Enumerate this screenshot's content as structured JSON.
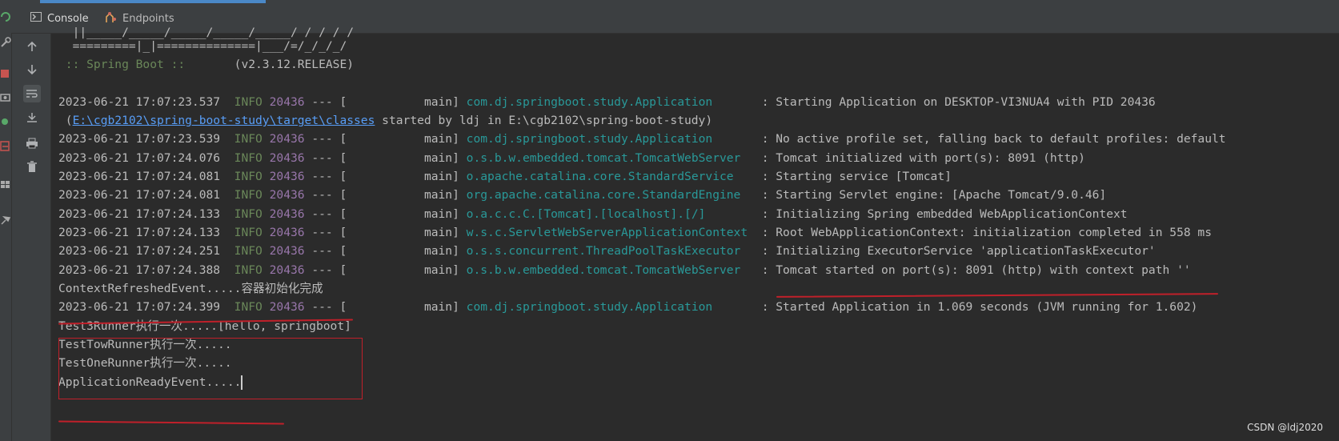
{
  "tabs": [
    {
      "label": "Console",
      "icon": "console-icon",
      "active": true
    },
    {
      "label": "Endpoints",
      "icon": "endpoints-icon",
      "active": false
    }
  ],
  "banner": {
    "line1": "  =========|_|==============|___/=/_/_/_/",
    "line2": " :: Spring Boot :: ",
    "line2_version": "      (v2.3.12.RELEASE)"
  },
  "log": [
    {
      "ts": "2023-06-21 17:07:23.537",
      "level": "INFO",
      "pid": "20436",
      "thread": "main",
      "logger": "com.dj.springboot.study.Application      ",
      "msg": "Starting Application on DESKTOP-VI3NUA4 with PID 20436"
    },
    {
      "ts": "2023-06-21 17:07:23.539",
      "level": "INFO",
      "pid": "20436",
      "thread": "main",
      "logger": "com.dj.springboot.study.Application      ",
      "msg": "No active profile set, falling back to default profiles: default"
    },
    {
      "ts": "2023-06-21 17:07:24.076",
      "level": "INFO",
      "pid": "20436",
      "thread": "main",
      "logger": "o.s.b.w.embedded.tomcat.TomcatWebServer  ",
      "msg": "Tomcat initialized with port(s): 8091 (http)"
    },
    {
      "ts": "2023-06-21 17:07:24.081",
      "level": "INFO",
      "pid": "20436",
      "thread": "main",
      "logger": "o.apache.catalina.core.StandardService   ",
      "msg": "Starting service [Tomcat]"
    },
    {
      "ts": "2023-06-21 17:07:24.081",
      "level": "INFO",
      "pid": "20436",
      "thread": "main",
      "logger": "org.apache.catalina.core.StandardEngine  ",
      "msg": "Starting Servlet engine: [Apache Tomcat/9.0.46]"
    },
    {
      "ts": "2023-06-21 17:07:24.133",
      "level": "INFO",
      "pid": "20436",
      "thread": "main",
      "logger": "o.a.c.c.C.[Tomcat].[localhost].[/]       ",
      "msg": "Initializing Spring embedded WebApplicationContext"
    },
    {
      "ts": "2023-06-21 17:07:24.133",
      "level": "INFO",
      "pid": "20436",
      "thread": "main",
      "logger": "w.s.c.ServletWebServerApplicationContext ",
      "msg": "Root WebApplicationContext: initialization completed in 558 ms"
    },
    {
      "ts": "2023-06-21 17:07:24.251",
      "level": "INFO",
      "pid": "20436",
      "thread": "main",
      "logger": "o.s.s.concurrent.ThreadPoolTaskExecutor  ",
      "msg": "Initializing ExecutorService 'applicationTaskExecutor'"
    },
    {
      "ts": "2023-06-21 17:07:24.388",
      "level": "INFO",
      "pid": "20436",
      "thread": "main",
      "logger": "o.s.b.w.embedded.tomcat.TomcatWebServer  ",
      "msg": "Tomcat started on port(s): 8091 (http) with context path ''"
    },
    {
      "ts": "2023-06-21 17:07:24.399",
      "level": "INFO",
      "pid": "20436",
      "thread": "main",
      "logger": "com.dj.springboot.study.Application      ",
      "msg": "Started Application in 1.069 seconds (JVM running for 1.602)"
    }
  ],
  "classpath_line": {
    "prefix": " (",
    "link": "E:\\cgb2102\\spring-boot-study\\target\\classes",
    "suffix": " started by ldj in E:\\cgb2102\\spring-boot-study)"
  },
  "plain_lines": {
    "context_refreshed": "ContextRefreshedEvent.....容器初始化完成",
    "runner3": "Test3Runner执行一次.....[hello, springboot]",
    "runner_tow": "TestTowRunner执行一次.....",
    "runner_one": "TestOneRunner执行一次.....",
    "app_ready": "ApplicationReadyEvent....."
  },
  "log_sep": " --- [           ",
  "watermark": "CSDN @ldj2020",
  "colors": {
    "annotation": "#c0202a",
    "info": "#6a8759",
    "pid": "#9876aa",
    "logger": "#299999",
    "link": "#589df6"
  }
}
